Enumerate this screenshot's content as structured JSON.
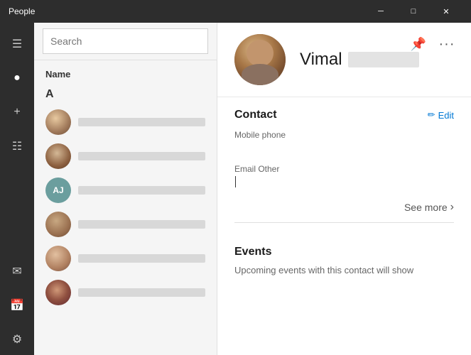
{
  "titlebar": {
    "title": "People",
    "minimize_label": "─",
    "maximize_label": "□",
    "close_label": "✕"
  },
  "sidebar": {
    "icons": [
      {
        "name": "menu-icon",
        "glyph": "☰"
      },
      {
        "name": "person-icon",
        "glyph": "👤"
      },
      {
        "name": "add-icon",
        "glyph": "+"
      },
      {
        "name": "filter-icon",
        "glyph": "⚡"
      },
      {
        "name": "mail-icon",
        "glyph": "✉"
      },
      {
        "name": "calendar-icon",
        "glyph": "📅"
      },
      {
        "name": "settings-icon",
        "glyph": "⚙"
      }
    ]
  },
  "contact_list": {
    "search_placeholder": "Search",
    "name_header": "Name",
    "alpha_header": "A",
    "contacts": [
      {
        "id": 1,
        "type": "photo",
        "photo_class": "photo-1"
      },
      {
        "id": 2,
        "type": "photo",
        "photo_class": "photo-2"
      },
      {
        "id": 3,
        "type": "initials",
        "initials": "AJ",
        "color_class": "avatar-teal"
      },
      {
        "id": 4,
        "type": "photo",
        "photo_class": "photo-3"
      },
      {
        "id": 5,
        "type": "photo",
        "photo_class": "photo-4"
      },
      {
        "id": 6,
        "type": "photo",
        "photo_class": "photo-5"
      }
    ]
  },
  "detail": {
    "contact_first_name": "Vimal",
    "header_actions": [
      {
        "name": "pin-icon",
        "glyph": "📌"
      },
      {
        "name": "more-icon",
        "glyph": "•••"
      }
    ],
    "contact_section": {
      "title": "Contact",
      "edit_label": "Edit",
      "edit_icon": "✏",
      "fields": [
        {
          "label": "Mobile phone",
          "value": ""
        },
        {
          "label": "Email Other",
          "value": "",
          "has_cursor": true
        }
      ],
      "see_more_label": "See more",
      "see_more_icon": "›"
    },
    "events_section": {
      "title": "Events",
      "description": "Upcoming events with this contact will show"
    }
  },
  "colors": {
    "accent": "#0078d4",
    "titlebar_bg": "#2d2d2d",
    "sidebar_bg": "#2d2d2d"
  }
}
